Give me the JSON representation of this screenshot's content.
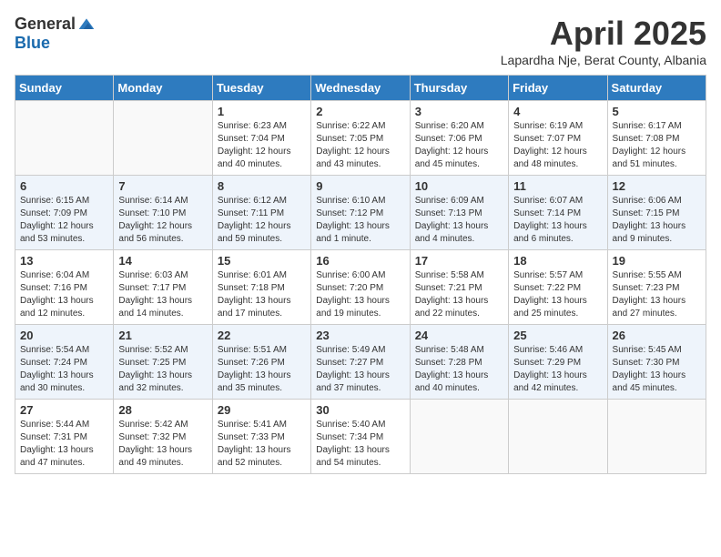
{
  "header": {
    "logo_general": "General",
    "logo_blue": "Blue",
    "month_title": "April 2025",
    "subtitle": "Lapardha Nje, Berat County, Albania"
  },
  "days_of_week": [
    "Sunday",
    "Monday",
    "Tuesday",
    "Wednesday",
    "Thursday",
    "Friday",
    "Saturday"
  ],
  "weeks": [
    [
      {
        "day": "",
        "sunrise": "",
        "sunset": "",
        "daylight": ""
      },
      {
        "day": "",
        "sunrise": "",
        "sunset": "",
        "daylight": ""
      },
      {
        "day": "1",
        "sunrise": "Sunrise: 6:23 AM",
        "sunset": "Sunset: 7:04 PM",
        "daylight": "Daylight: 12 hours and 40 minutes."
      },
      {
        "day": "2",
        "sunrise": "Sunrise: 6:22 AM",
        "sunset": "Sunset: 7:05 PM",
        "daylight": "Daylight: 12 hours and 43 minutes."
      },
      {
        "day": "3",
        "sunrise": "Sunrise: 6:20 AM",
        "sunset": "Sunset: 7:06 PM",
        "daylight": "Daylight: 12 hours and 45 minutes."
      },
      {
        "day": "4",
        "sunrise": "Sunrise: 6:19 AM",
        "sunset": "Sunset: 7:07 PM",
        "daylight": "Daylight: 12 hours and 48 minutes."
      },
      {
        "day": "5",
        "sunrise": "Sunrise: 6:17 AM",
        "sunset": "Sunset: 7:08 PM",
        "daylight": "Daylight: 12 hours and 51 minutes."
      }
    ],
    [
      {
        "day": "6",
        "sunrise": "Sunrise: 6:15 AM",
        "sunset": "Sunset: 7:09 PM",
        "daylight": "Daylight: 12 hours and 53 minutes."
      },
      {
        "day": "7",
        "sunrise": "Sunrise: 6:14 AM",
        "sunset": "Sunset: 7:10 PM",
        "daylight": "Daylight: 12 hours and 56 minutes."
      },
      {
        "day": "8",
        "sunrise": "Sunrise: 6:12 AM",
        "sunset": "Sunset: 7:11 PM",
        "daylight": "Daylight: 12 hours and 59 minutes."
      },
      {
        "day": "9",
        "sunrise": "Sunrise: 6:10 AM",
        "sunset": "Sunset: 7:12 PM",
        "daylight": "Daylight: 13 hours and 1 minute."
      },
      {
        "day": "10",
        "sunrise": "Sunrise: 6:09 AM",
        "sunset": "Sunset: 7:13 PM",
        "daylight": "Daylight: 13 hours and 4 minutes."
      },
      {
        "day": "11",
        "sunrise": "Sunrise: 6:07 AM",
        "sunset": "Sunset: 7:14 PM",
        "daylight": "Daylight: 13 hours and 6 minutes."
      },
      {
        "day": "12",
        "sunrise": "Sunrise: 6:06 AM",
        "sunset": "Sunset: 7:15 PM",
        "daylight": "Daylight: 13 hours and 9 minutes."
      }
    ],
    [
      {
        "day": "13",
        "sunrise": "Sunrise: 6:04 AM",
        "sunset": "Sunset: 7:16 PM",
        "daylight": "Daylight: 13 hours and 12 minutes."
      },
      {
        "day": "14",
        "sunrise": "Sunrise: 6:03 AM",
        "sunset": "Sunset: 7:17 PM",
        "daylight": "Daylight: 13 hours and 14 minutes."
      },
      {
        "day": "15",
        "sunrise": "Sunrise: 6:01 AM",
        "sunset": "Sunset: 7:18 PM",
        "daylight": "Daylight: 13 hours and 17 minutes."
      },
      {
        "day": "16",
        "sunrise": "Sunrise: 6:00 AM",
        "sunset": "Sunset: 7:20 PM",
        "daylight": "Daylight: 13 hours and 19 minutes."
      },
      {
        "day": "17",
        "sunrise": "Sunrise: 5:58 AM",
        "sunset": "Sunset: 7:21 PM",
        "daylight": "Daylight: 13 hours and 22 minutes."
      },
      {
        "day": "18",
        "sunrise": "Sunrise: 5:57 AM",
        "sunset": "Sunset: 7:22 PM",
        "daylight": "Daylight: 13 hours and 25 minutes."
      },
      {
        "day": "19",
        "sunrise": "Sunrise: 5:55 AM",
        "sunset": "Sunset: 7:23 PM",
        "daylight": "Daylight: 13 hours and 27 minutes."
      }
    ],
    [
      {
        "day": "20",
        "sunrise": "Sunrise: 5:54 AM",
        "sunset": "Sunset: 7:24 PM",
        "daylight": "Daylight: 13 hours and 30 minutes."
      },
      {
        "day": "21",
        "sunrise": "Sunrise: 5:52 AM",
        "sunset": "Sunset: 7:25 PM",
        "daylight": "Daylight: 13 hours and 32 minutes."
      },
      {
        "day": "22",
        "sunrise": "Sunrise: 5:51 AM",
        "sunset": "Sunset: 7:26 PM",
        "daylight": "Daylight: 13 hours and 35 minutes."
      },
      {
        "day": "23",
        "sunrise": "Sunrise: 5:49 AM",
        "sunset": "Sunset: 7:27 PM",
        "daylight": "Daylight: 13 hours and 37 minutes."
      },
      {
        "day": "24",
        "sunrise": "Sunrise: 5:48 AM",
        "sunset": "Sunset: 7:28 PM",
        "daylight": "Daylight: 13 hours and 40 minutes."
      },
      {
        "day": "25",
        "sunrise": "Sunrise: 5:46 AM",
        "sunset": "Sunset: 7:29 PM",
        "daylight": "Daylight: 13 hours and 42 minutes."
      },
      {
        "day": "26",
        "sunrise": "Sunrise: 5:45 AM",
        "sunset": "Sunset: 7:30 PM",
        "daylight": "Daylight: 13 hours and 45 minutes."
      }
    ],
    [
      {
        "day": "27",
        "sunrise": "Sunrise: 5:44 AM",
        "sunset": "Sunset: 7:31 PM",
        "daylight": "Daylight: 13 hours and 47 minutes."
      },
      {
        "day": "28",
        "sunrise": "Sunrise: 5:42 AM",
        "sunset": "Sunset: 7:32 PM",
        "daylight": "Daylight: 13 hours and 49 minutes."
      },
      {
        "day": "29",
        "sunrise": "Sunrise: 5:41 AM",
        "sunset": "Sunset: 7:33 PM",
        "daylight": "Daylight: 13 hours and 52 minutes."
      },
      {
        "day": "30",
        "sunrise": "Sunrise: 5:40 AM",
        "sunset": "Sunset: 7:34 PM",
        "daylight": "Daylight: 13 hours and 54 minutes."
      },
      {
        "day": "",
        "sunrise": "",
        "sunset": "",
        "daylight": ""
      },
      {
        "day": "",
        "sunrise": "",
        "sunset": "",
        "daylight": ""
      },
      {
        "day": "",
        "sunrise": "",
        "sunset": "",
        "daylight": ""
      }
    ]
  ]
}
